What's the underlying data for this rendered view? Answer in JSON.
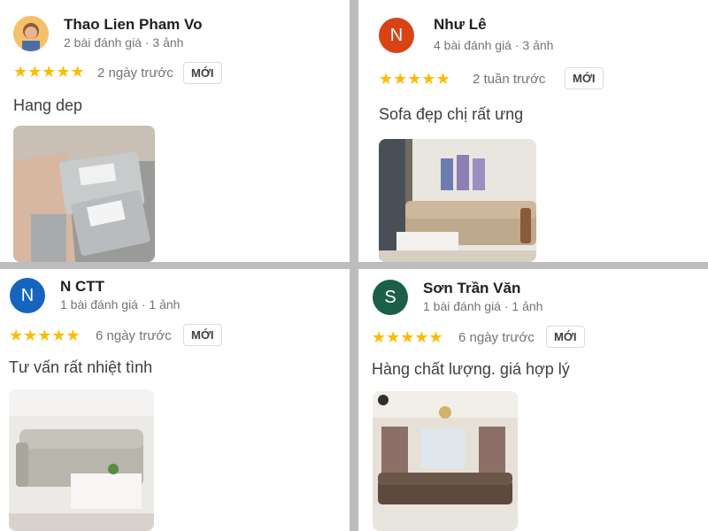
{
  "reviews": [
    {
      "name": "Thao Lien Pham Vo",
      "meta": "2 bài đánh giá · 3 ảnh",
      "stars": "★★★★★",
      "date": "2 ngày trước",
      "badge": "MỚI",
      "text": "Hang dep",
      "avatar_letter": "",
      "avatar_color": "#f2c26b",
      "photo": "fabric-swatch-photo"
    },
    {
      "name": "Như Lê",
      "meta": "4 bài đánh giá · 3 ảnh",
      "stars": "★★★★★",
      "date": "2 tuần trước",
      "badge": "MỚI",
      "text": "Sofa đẹp chị rất ưng",
      "avatar_letter": "N",
      "avatar_color": "#d84315",
      "photo": "living-room-sofa-photo"
    },
    {
      "name": "N CTT",
      "meta": "1 bài đánh giá · 1 ảnh",
      "stars": "★★★★★",
      "date": "6 ngày trước",
      "badge": "MỚI",
      "text": "Tư vấn rất nhiệt tình",
      "avatar_letter": "N",
      "avatar_color": "#1565c0",
      "photo": "grey-sofa-photo"
    },
    {
      "name": "Sơn Trần Văn",
      "meta": "1 bài đánh giá · 1 ảnh",
      "stars": "★★★★★",
      "date": "6 ngày trước",
      "badge": "MỚI",
      "text": "Hàng chất lượng. giá hợp lý",
      "avatar_letter": "S",
      "avatar_color": "#1b5e4a",
      "photo": "leather-sectional-photo"
    }
  ],
  "colors": {
    "star": "#fbbc04",
    "meta_text": "#70757a",
    "divider": "#bdbdbd"
  }
}
